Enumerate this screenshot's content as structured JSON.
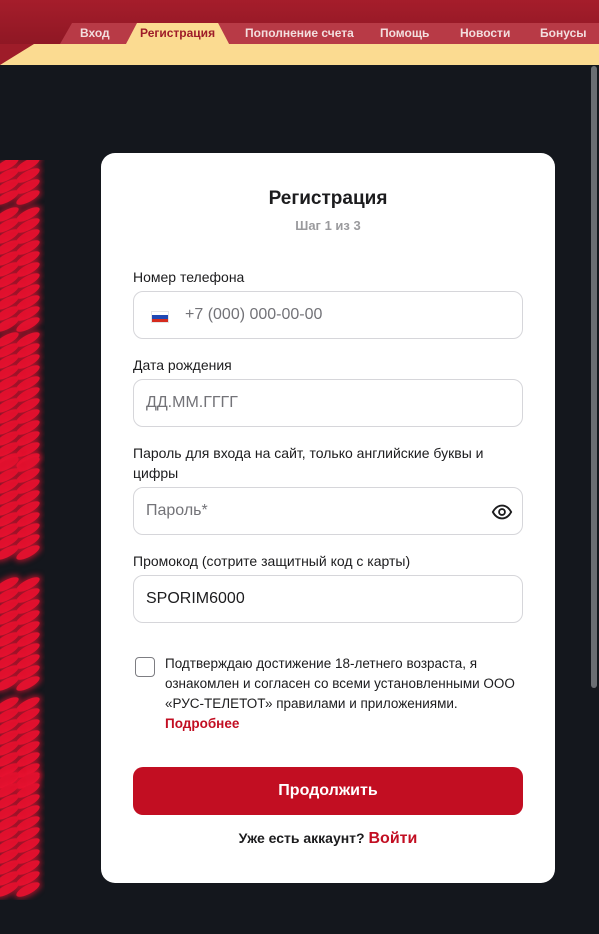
{
  "nav": {
    "items": [
      {
        "label": "Вход"
      },
      {
        "label": "Регистрация",
        "active": true
      },
      {
        "label": "Пополнение счета"
      },
      {
        "label": "Помощь"
      },
      {
        "label": "Новости"
      },
      {
        "label": "Бонусы"
      }
    ]
  },
  "form": {
    "title": "Регистрация",
    "step": "Шаг 1 из 3",
    "phone": {
      "label": "Номер телефона",
      "placeholder": "+7 (000) 000-00-00",
      "flag_icon": "russia-flag-icon"
    },
    "birthdate": {
      "label": "Дата рождения",
      "placeholder": "ДД.ММ.ГГГГ"
    },
    "password": {
      "label": "Пароль для входа на сайт, только английские буквы и цифры",
      "placeholder": "Пароль*",
      "toggle_icon": "eye-icon"
    },
    "promo": {
      "label": "Промокод (сотрите защитный код с карты)",
      "value": "SPORIM6000"
    },
    "consent": {
      "text": "Подтверждаю достижение 18-летнего возраста, я ознакомлен и согласен со всеми установленными ООО «РУС-ТЕЛЕТОТ» правилами и приложениями.",
      "more_link": "Подробнее",
      "checked": false
    },
    "submit_label": "Продолжить",
    "footer": {
      "text": "Уже есть аккаунт?",
      "login_link": "Войти"
    }
  },
  "colors": {
    "accent": "#c20e22",
    "nav_red": "#9e1c29",
    "nav_yellow": "#fbdb91",
    "background": "#14171d"
  }
}
